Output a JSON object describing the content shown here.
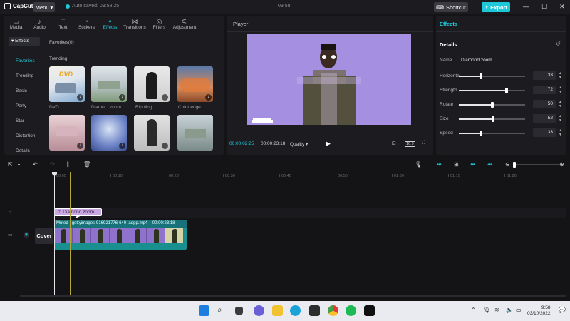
{
  "titlebar": {
    "app_name": "CapCut",
    "menu_label": "Menu",
    "autosave": "Auto saved: 09:58:25",
    "center_time": "09:58",
    "shortcut_label": "Shortcut",
    "export_label": "Export"
  },
  "categories": [
    {
      "label": "Media",
      "icon": "media-icon",
      "glyph": "▭"
    },
    {
      "label": "Audio",
      "icon": "audio-icon",
      "glyph": "♪"
    },
    {
      "label": "Text",
      "icon": "text-icon",
      "glyph": "T"
    },
    {
      "label": "Stickers",
      "icon": "stickers-icon",
      "glyph": "◔"
    },
    {
      "label": "Effects",
      "icon": "effects-icon",
      "glyph": "✦"
    },
    {
      "label": "Transitions",
      "icon": "transitions-icon",
      "glyph": "⋈"
    },
    {
      "label": "Filters",
      "icon": "filters-icon",
      "glyph": "◎"
    },
    {
      "label": "Adjustment",
      "icon": "adjustment-icon",
      "glyph": "⚟"
    }
  ],
  "sidebar": {
    "header": "Effects",
    "items": [
      "Favorites",
      "Trending",
      "Basic",
      "Party",
      "Star",
      "Distortion",
      "Details"
    ]
  },
  "effects_panel": {
    "favorites_label": "Favorites(0)",
    "trending_label": "Trending",
    "thumbnails": [
      {
        "label": "DVD",
        "overlay": "DVD"
      },
      {
        "label": "Diamo... zoom",
        "overlay": ""
      },
      {
        "label": "Rippling",
        "overlay": ""
      },
      {
        "label": "Color edge",
        "overlay": ""
      },
      {
        "label": "",
        "overlay": ""
      },
      {
        "label": "",
        "overlay": ""
      },
      {
        "label": "",
        "overlay": ""
      },
      {
        "label": "",
        "overlay": ""
      }
    ]
  },
  "player": {
    "title": "Player",
    "current_time": "00:00:02:25",
    "duration": "00:00:23:18",
    "quality_label": "Quality",
    "ratio_label": "16:9"
  },
  "details": {
    "panel_title": "Effects",
    "section_label": "Details",
    "name_label": "Name",
    "name_value": "Diamond zoom",
    "params": [
      {
        "label": "Horizontal",
        "value": "33",
        "level": 0.33
      },
      {
        "label": "Strength",
        "value": "72",
        "level": 0.72
      },
      {
        "label": "Rotate",
        "value": "50",
        "level": 0.5
      },
      {
        "label": "Size",
        "value": "52",
        "level": 0.52
      },
      {
        "label": "Speed",
        "value": "33",
        "level": 0.33
      }
    ]
  },
  "timeline": {
    "ruler_labels": [
      "00:00",
      "00:10",
      "00:20",
      "00:30",
      "00:40",
      "00:50",
      "01:00",
      "01:10",
      "01:20"
    ],
    "effect_clip_label": "Diamond zoom",
    "video_clip": {
      "muted": "Muted",
      "filename": "gettyimages-916921776-640_adpp.mp4",
      "duration": "00:00:23:18"
    },
    "cover_label": "Cover"
  },
  "taskbar": {
    "time": "9:58",
    "date": "03/10/2022"
  },
  "colors": {
    "accent": "#1fc8d8",
    "effect_clip": "#c9a7e0",
    "video_clip": "#1a8f8f"
  }
}
